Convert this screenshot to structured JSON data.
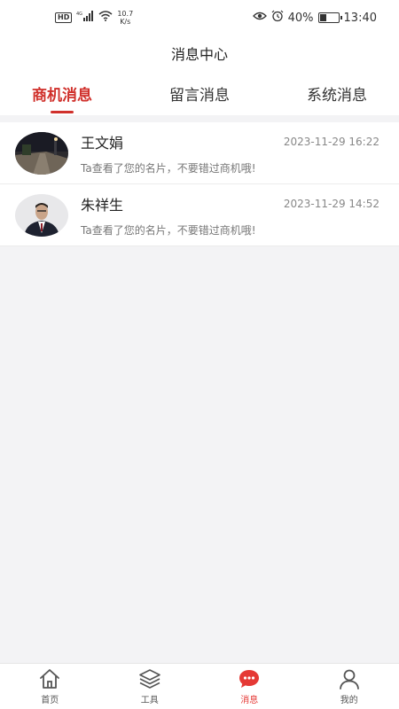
{
  "status": {
    "hd": "HD",
    "network": "4G",
    "speed_value": "10.7",
    "speed_unit": "K/s",
    "battery": "40%",
    "battery_level": 0.4,
    "time": "13:40"
  },
  "header": {
    "title": "消息中心"
  },
  "tabs": [
    {
      "label": "商机消息",
      "active": true
    },
    {
      "label": "留言消息",
      "active": false
    },
    {
      "label": "系统消息",
      "active": false
    }
  ],
  "messages": [
    {
      "name": "王文娟",
      "time": "2023-11-29 16:22",
      "text": "Ta查看了您的名片，不要错过商机哦!"
    },
    {
      "name": "朱祥生",
      "time": "2023-11-29 14:52",
      "text": "Ta查看了您的名片，不要错过商机哦!"
    }
  ],
  "nav": [
    {
      "label": "首页",
      "icon": "home-icon"
    },
    {
      "label": "工具",
      "icon": "layers-icon"
    },
    {
      "label": "消息",
      "icon": "chat-icon"
    },
    {
      "label": "我的",
      "icon": "user-icon"
    }
  ],
  "colors": {
    "accent": "#d0302b",
    "nav_active": "#e53935"
  }
}
